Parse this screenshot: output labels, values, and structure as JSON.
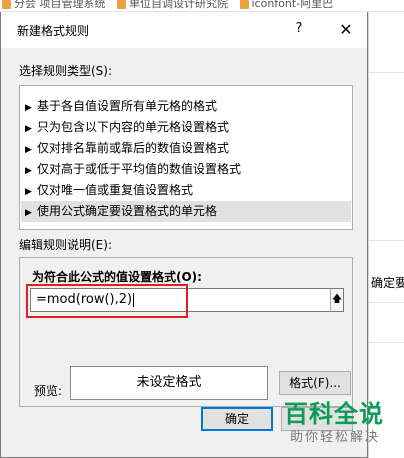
{
  "background_app": {
    "tabs": [
      "分会 项目管理系统",
      "单位自调设计研究院",
      "iconfont-阿里巴"
    ],
    "right_edge_text": "确定要"
  },
  "dialog": {
    "title": "新建格式规则",
    "help_label": "?",
    "close_label": "✕",
    "rule_type_label": "选择规则类型(S):",
    "rule_types": [
      {
        "label": "基于各自值设置所有单元格的格式",
        "selected": false
      },
      {
        "label": "只为包含以下内容的单元格设置格式",
        "selected": false
      },
      {
        "label": "仅对排名靠前或靠后的数值设置格式",
        "selected": false
      },
      {
        "label": "仅对高于或低于平均值的数值设置格式",
        "selected": false
      },
      {
        "label": "仅对唯一值或重复值设置格式",
        "selected": false
      },
      {
        "label": "使用公式确定要设置格式的单元格",
        "selected": true
      }
    ],
    "edit_description_label": "编辑规则说明(E):",
    "formula_label": "为符合此公式的值设置格式(O):",
    "formula_value": "=mod(row(),2)",
    "preview_label": "预览:",
    "preview_text": "未设定格式",
    "format_button_label": "格式(F)...",
    "ok_button_label": "确定",
    "cancel_button_label": ""
  },
  "watermark": {
    "main": "百科全说",
    "sub": "助你轻松解决"
  }
}
